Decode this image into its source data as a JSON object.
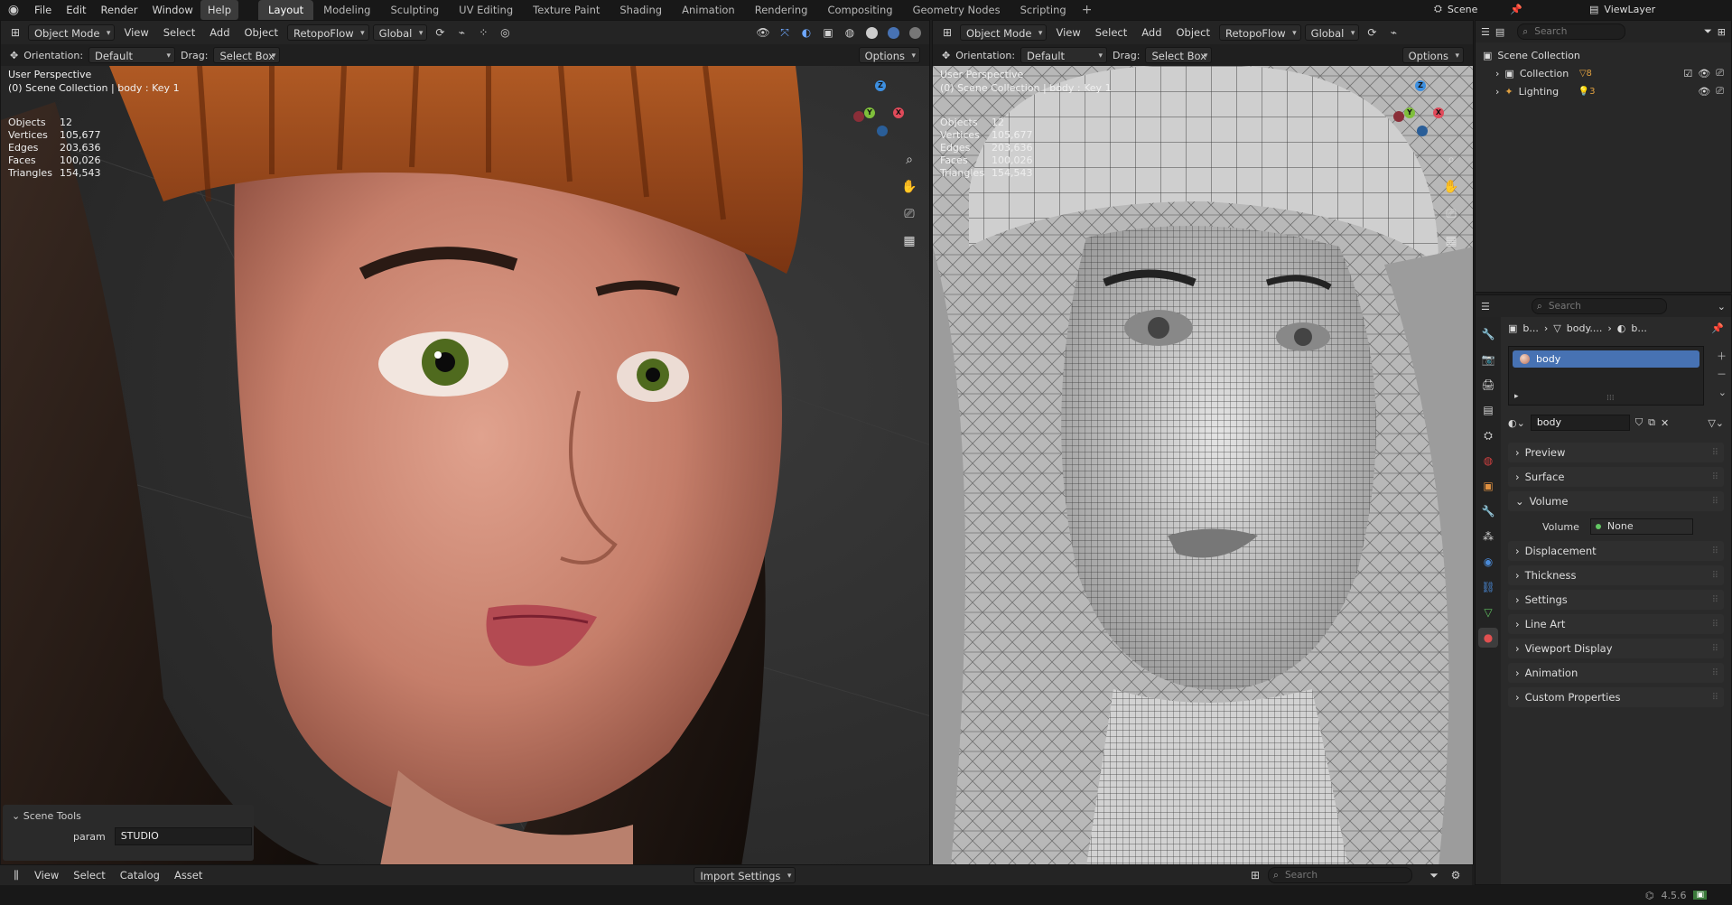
{
  "topbar": {
    "menus": [
      "File",
      "Edit",
      "Render",
      "Window",
      "Help"
    ],
    "workspaces": [
      "Layout",
      "Modeling",
      "Sculpting",
      "UV Editing",
      "Texture Paint",
      "Shading",
      "Animation",
      "Rendering",
      "Compositing",
      "Geometry Nodes",
      "Scripting"
    ],
    "active_workspace": "Layout",
    "add_tab": "+",
    "scene_label": "Scene",
    "viewlayer_label": "ViewLayer"
  },
  "viewport_left": {
    "mode": "Object Mode",
    "menus": [
      "View",
      "Select",
      "Add",
      "Object"
    ],
    "addon": "RetopoFlow",
    "transform": "Global",
    "orientation_label": "Orientation:",
    "orientation_value": "Default",
    "drag_label": "Drag:",
    "drag_value": "Select Box",
    "options": "Options",
    "perspective": "User Perspective",
    "collection_info": "(0) Scene Collection | body : Key 1",
    "stats": [
      {
        "k": "Objects",
        "v": "12"
      },
      {
        "k": "Vertices",
        "v": "105,677"
      },
      {
        "k": "Edges",
        "v": "203,636"
      },
      {
        "k": "Faces",
        "v": "100,026"
      },
      {
        "k": "Triangles",
        "v": "154,543"
      }
    ],
    "scene_tools": {
      "title": "Scene Tools",
      "param_label": "param",
      "param_value": "STUDIO"
    }
  },
  "viewport_right": {
    "mode": "Object Mode",
    "menus": [
      "View",
      "Select",
      "Add",
      "Object"
    ],
    "addon": "RetopoFlow",
    "transform": "Global",
    "orientation_label": "Orientation:",
    "orientation_value": "Default",
    "drag_label": "Drag:",
    "drag_value": "Select Box",
    "options": "Options",
    "perspective": "User Perspective",
    "collection_info": "(0) Scene Collection | body : Key 1",
    "stats": [
      {
        "k": "Objects",
        "v": "12"
      },
      {
        "k": "Vertices",
        "v": "105,677"
      },
      {
        "k": "Edges",
        "v": "203,636"
      },
      {
        "k": "Faces",
        "v": "100,026"
      },
      {
        "k": "Triangles",
        "v": "154,543"
      }
    ]
  },
  "gizmo": {
    "x": "X",
    "y": "Y",
    "z": "Z"
  },
  "outliner": {
    "search": "Search",
    "root": "Scene Collection",
    "items": [
      {
        "label": "Collection",
        "count": "8"
      },
      {
        "label": "Lighting",
        "count": "3"
      }
    ]
  },
  "properties": {
    "search": "Search",
    "breadcrumb": [
      "b...",
      "body....",
      "b..."
    ],
    "material_slot": "body",
    "material_name": "body",
    "sections": [
      "Preview",
      "Surface",
      "Volume",
      "Displacement",
      "Thickness",
      "Settings",
      "Line Art",
      "Viewport Display",
      "Animation",
      "Custom Properties"
    ],
    "volume_label": "Volume",
    "volume_value": "None"
  },
  "asset_bar": {
    "menus": [
      "View",
      "Select",
      "Catalog",
      "Asset"
    ],
    "import_settings": "Import Settings",
    "search": "Search"
  },
  "status": {
    "version": "4.5.6"
  },
  "colors": {
    "accent": "#4772b3",
    "x_axis": "#e04a5a",
    "y_axis": "#7fbf3b",
    "z_axis": "#3d8fe0"
  }
}
